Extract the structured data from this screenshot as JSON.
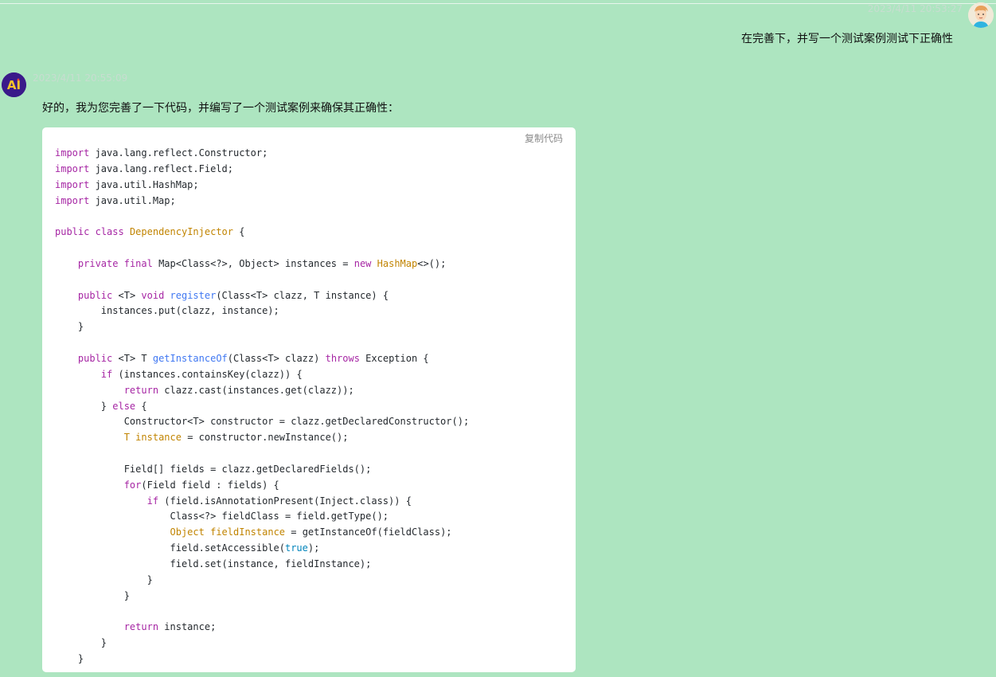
{
  "user_message": {
    "timestamp": "2023/4/11 20:53:27",
    "text": "在完善下，并写一个测试案例测试下正确性",
    "avatar": "user-avatar-icon"
  },
  "ai_message": {
    "timestamp": "2023/4/11 20:55:09",
    "intro": "好的，我为您完善了一下代码，并编写了一个测试案例来确保其正确性：",
    "avatar": "ai-logo-icon",
    "avatar_label": "AI",
    "code_block": {
      "copy_label": "复制代码",
      "language": "java",
      "lines": [
        [
          {
            "t": "import",
            "c": "kw"
          },
          {
            "t": " java.lang.reflect.Constructor;"
          }
        ],
        [
          {
            "t": "import",
            "c": "kw"
          },
          {
            "t": " java.lang.reflect.Field;"
          }
        ],
        [
          {
            "t": "import",
            "c": "kw"
          },
          {
            "t": " java.util.HashMap;"
          }
        ],
        [
          {
            "t": "import",
            "c": "kw"
          },
          {
            "t": " java.util.Map;"
          }
        ],
        [],
        [
          {
            "t": "public",
            "c": "kw"
          },
          {
            "t": " "
          },
          {
            "t": "class",
            "c": "kw"
          },
          {
            "t": " "
          },
          {
            "t": "DependencyInjector",
            "c": "ty"
          },
          {
            "t": " {"
          }
        ],
        [],
        [
          {
            "t": "    "
          },
          {
            "t": "private",
            "c": "kw"
          },
          {
            "t": " "
          },
          {
            "t": "final",
            "c": "kw"
          },
          {
            "t": " Map<Class<?>, Object> instances = "
          },
          {
            "t": "new",
            "c": "kw"
          },
          {
            "t": " "
          },
          {
            "t": "HashMap",
            "c": "ty"
          },
          {
            "t": "<>();"
          }
        ],
        [],
        [
          {
            "t": "    "
          },
          {
            "t": "public",
            "c": "kw"
          },
          {
            "t": " <T> "
          },
          {
            "t": "void",
            "c": "kw"
          },
          {
            "t": " "
          },
          {
            "t": "register",
            "c": "fn"
          },
          {
            "t": "(Class<T> clazz, T instance) {"
          }
        ],
        [
          {
            "t": "        instances.put(clazz, instance);"
          }
        ],
        [
          {
            "t": "    }"
          }
        ],
        [],
        [
          {
            "t": "    "
          },
          {
            "t": "public",
            "c": "kw"
          },
          {
            "t": " <T> T "
          },
          {
            "t": "getInstanceOf",
            "c": "fn"
          },
          {
            "t": "(Class<T> clazz) "
          },
          {
            "t": "throws",
            "c": "kw"
          },
          {
            "t": " Exception {"
          }
        ],
        [
          {
            "t": "        "
          },
          {
            "t": "if",
            "c": "kw"
          },
          {
            "t": " (instances.containsKey(clazz)) {"
          }
        ],
        [
          {
            "t": "            "
          },
          {
            "t": "return",
            "c": "kw"
          },
          {
            "t": " clazz.cast(instances.get(clazz));"
          }
        ],
        [
          {
            "t": "        } "
          },
          {
            "t": "else",
            "c": "kw"
          },
          {
            "t": " {"
          }
        ],
        [
          {
            "t": "            Constructor<T> constructor = clazz.getDeclaredConstructor();"
          }
        ],
        [
          {
            "t": "            "
          },
          {
            "t": "T",
            "c": "ty"
          },
          {
            "t": " "
          },
          {
            "t": "instance",
            "c": "ty"
          },
          {
            "t": " = constructor.newInstance();"
          }
        ],
        [],
        [
          {
            "t": "            Field[] fields = clazz.getDeclaredFields();"
          }
        ],
        [
          {
            "t": "            "
          },
          {
            "t": "for",
            "c": "kw"
          },
          {
            "t": "(Field field : fields) {"
          }
        ],
        [
          {
            "t": "                "
          },
          {
            "t": "if",
            "c": "kw"
          },
          {
            "t": " (field.isAnnotationPresent(Inject.class)) {"
          }
        ],
        [
          {
            "t": "                    Class<?> fieldClass = field.getType();"
          }
        ],
        [
          {
            "t": "                    "
          },
          {
            "t": "Object",
            "c": "ty"
          },
          {
            "t": " "
          },
          {
            "t": "fieldInstance",
            "c": "ty"
          },
          {
            "t": " = getInstanceOf(fieldClass);"
          }
        ],
        [
          {
            "t": "                    field.setAccessible("
          },
          {
            "t": "true",
            "c": "lit"
          },
          {
            "t": ");"
          }
        ],
        [
          {
            "t": "                    field.set(instance, fieldInstance);"
          }
        ],
        [
          {
            "t": "                }"
          }
        ],
        [
          {
            "t": "            }"
          }
        ],
        [],
        [
          {
            "t": "            "
          },
          {
            "t": "return",
            "c": "kw"
          },
          {
            "t": " instance;"
          }
        ],
        [
          {
            "t": "        }"
          }
        ],
        [
          {
            "t": "    }"
          }
        ]
      ]
    }
  },
  "colors": {
    "background": "#ade5c0",
    "code_background": "#ffffff",
    "keyword": "#a626a4",
    "type": "#c18401",
    "function": "#4078f2",
    "literal": "#0184bb",
    "timestamp": "#c7ddd0"
  }
}
